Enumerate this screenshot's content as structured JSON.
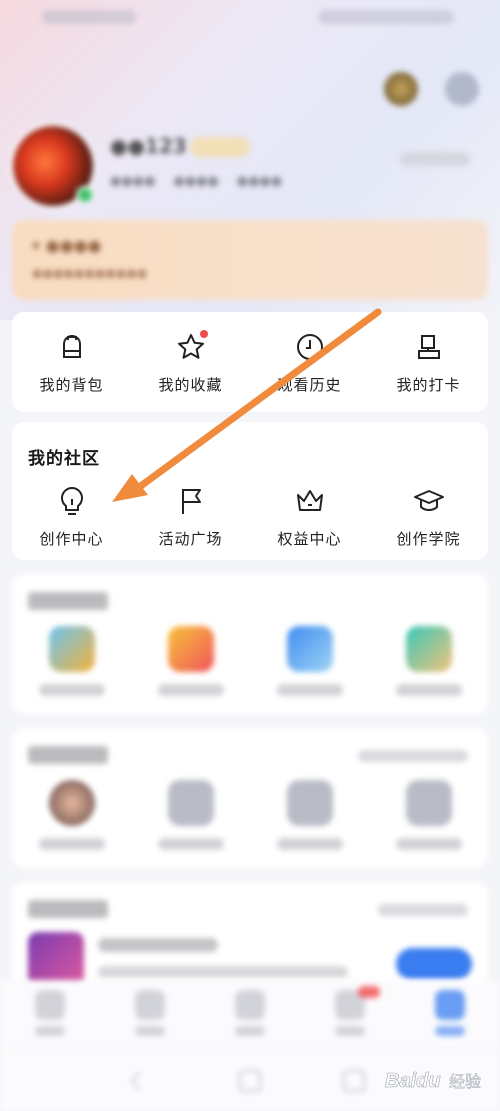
{
  "frequent_tools": {
    "items": [
      {
        "label": "我的背包",
        "icon": "backpack-icon",
        "badge": false
      },
      {
        "label": "我的收藏",
        "icon": "star-icon",
        "badge": true
      },
      {
        "label": "观看历史",
        "icon": "clock-icon",
        "badge": false
      },
      {
        "label": "我的打卡",
        "icon": "checkin-icon",
        "badge": false
      }
    ]
  },
  "community": {
    "title": "我的社区",
    "items": [
      {
        "label": "创作中心",
        "icon": "lightbulb-icon"
      },
      {
        "label": "活动广场",
        "icon": "flag-icon"
      },
      {
        "label": "权益中心",
        "icon": "crown-icon"
      },
      {
        "label": "创作学院",
        "icon": "graduation-cap-icon"
      }
    ]
  },
  "colors": {
    "arrow": "#f08a3c",
    "badge_red": "#f24a4a",
    "nav_active": "#3a7df0",
    "banner": "#f9dcc0"
  },
  "watermark": {
    "brand": "Baidu",
    "suffix": "经验"
  }
}
